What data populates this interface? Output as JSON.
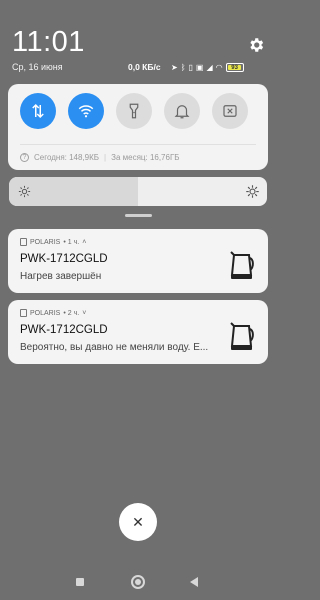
{
  "status": {
    "time": "11:01",
    "date": "Ср, 16 июня",
    "net_speed": "0,0 КБ/с",
    "battery": "93",
    "icons": [
      "location-icon",
      "bluetooth-icon",
      "vibrate-icon",
      "volte-icon",
      "signal-icon",
      "wifi-icon",
      "battery-icon"
    ]
  },
  "quick_settings": {
    "tiles": [
      {
        "name": "mobile-data",
        "on": true
      },
      {
        "name": "wifi",
        "on": true
      },
      {
        "name": "flashlight",
        "on": false
      },
      {
        "name": "notification-bell",
        "on": false
      },
      {
        "name": "screenshot",
        "on": false
      }
    ],
    "usage_today": "Сегодня: 148,9КБ",
    "usage_separator": "|",
    "usage_month": "За месяц: 16,76ГБ",
    "accent": "#2b8ff2"
  },
  "brightness": {
    "level": 0.5
  },
  "notifications": [
    {
      "app": "POLARIS",
      "time": "• 1 ч.",
      "chevron": "˄",
      "title": "PWK-1712CGLD",
      "body": "Нагрев завершён"
    },
    {
      "app": "POLARIS",
      "time": "• 2 ч.",
      "chevron": "˅",
      "title": "PWK-1712CGLD",
      "body": "Вероятно, вы давно не меняли воду. Е..."
    }
  ],
  "close_label": "✕"
}
